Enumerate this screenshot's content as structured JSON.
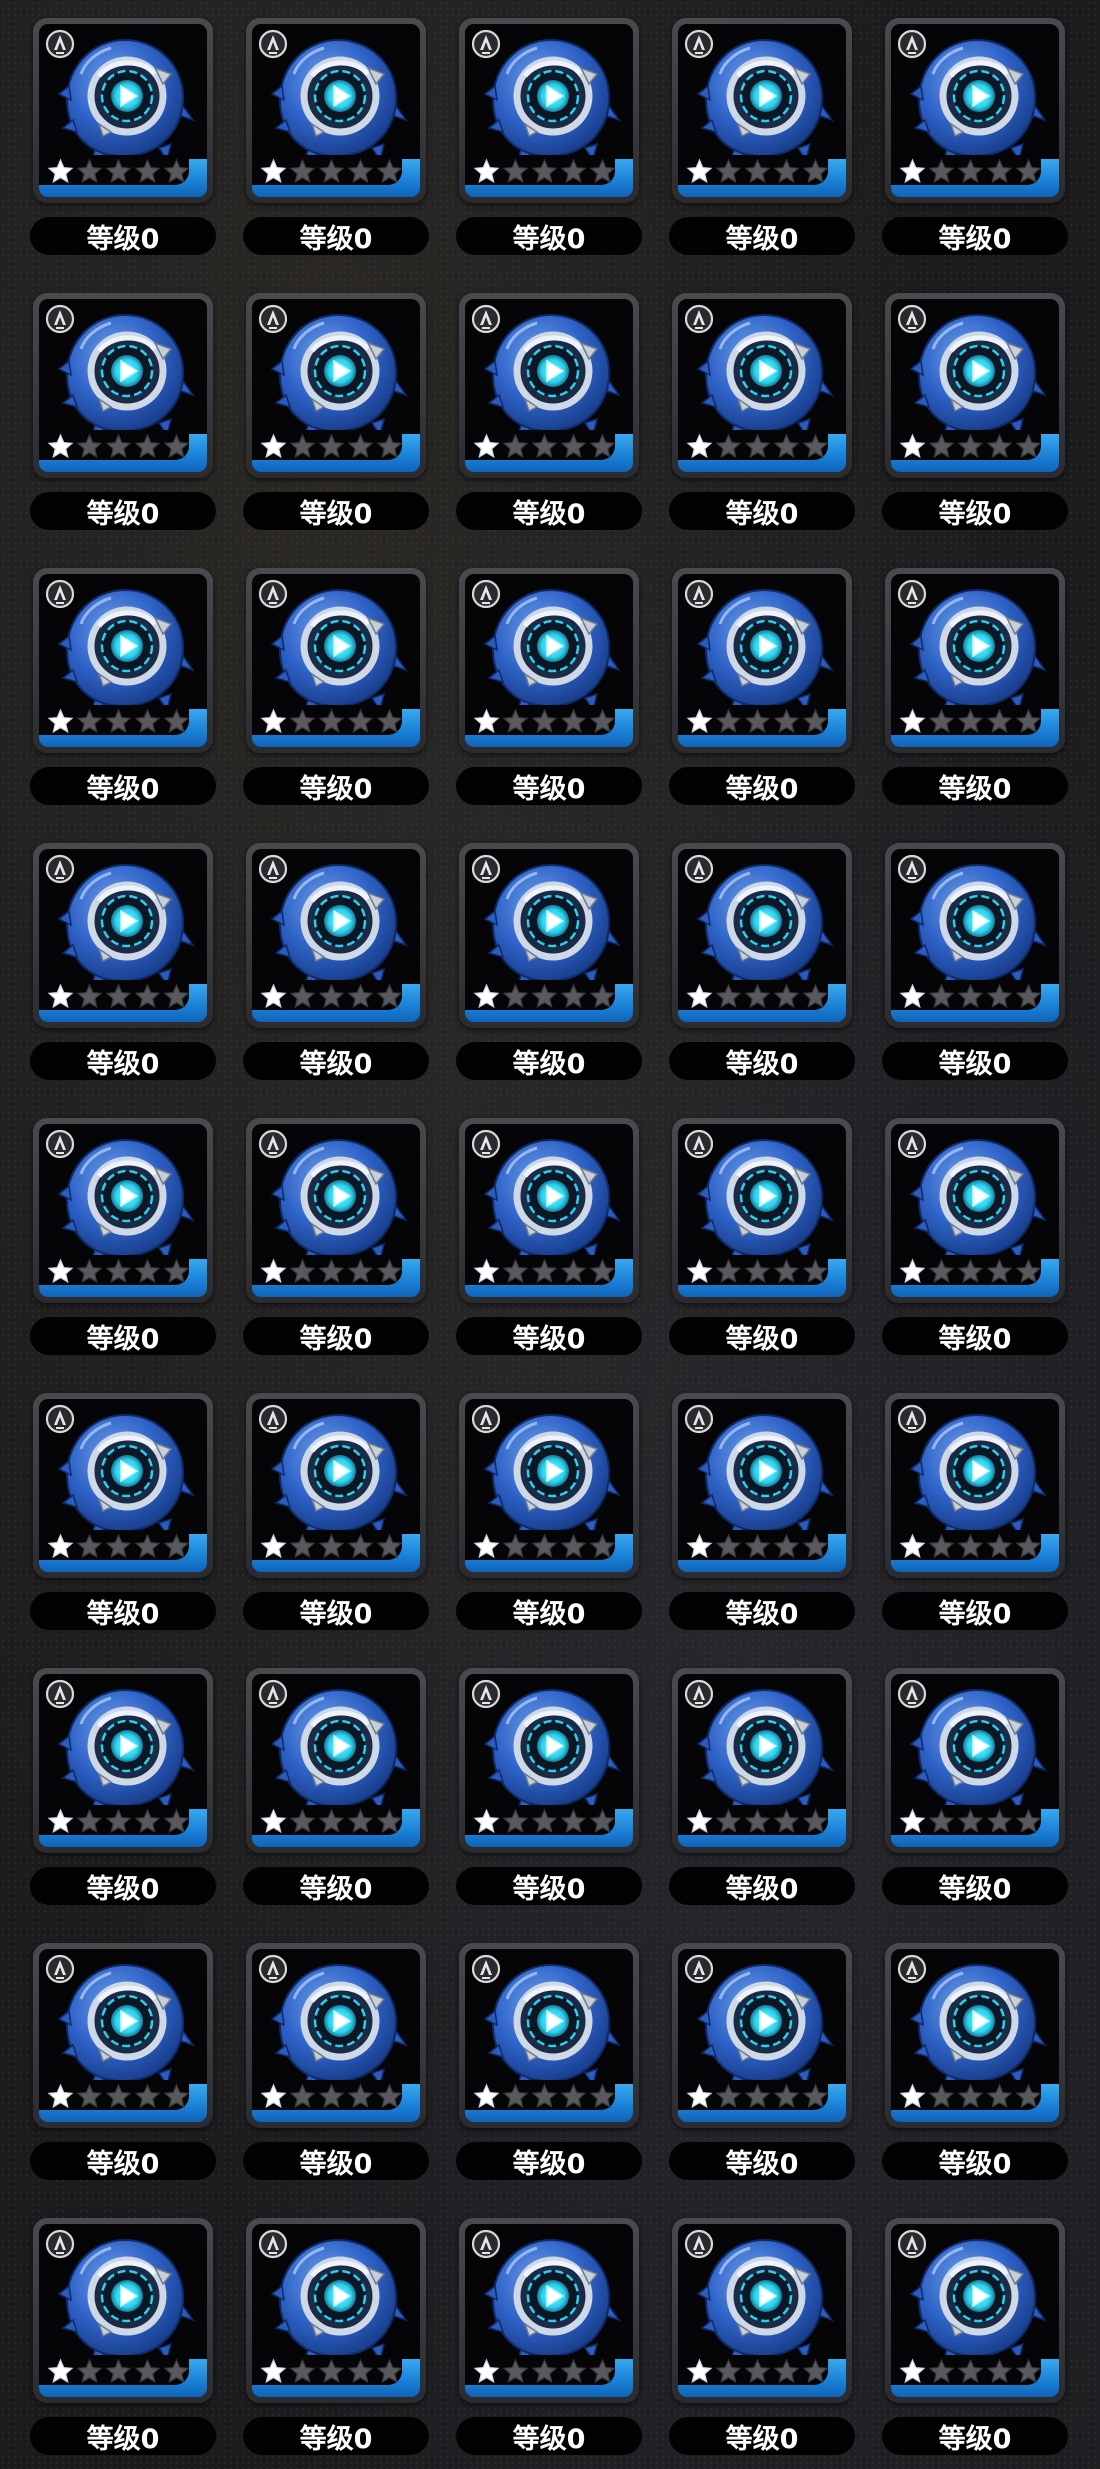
{
  "grid": {
    "rows": 9,
    "columns": 5
  },
  "item": {
    "name_icon": "blue-spiked-orb-gear-icon",
    "rarity_icon": "rarity-emblem-icon",
    "level_label": "等级0",
    "stars_total": 5,
    "stars_filled": 1
  },
  "colors": {
    "star_filled": "#ffffff",
    "star_empty": "#5a5a5e",
    "rarity_bar": "#2a93e5",
    "orb_primary": "#2f63c8",
    "core_glow": "#3fd7f0",
    "card_border": "#3c3c41",
    "level_pill_bg": "#020203"
  },
  "items": [
    {
      "level_label": "等级0"
    },
    {
      "level_label": "等级0"
    },
    {
      "level_label": "等级0"
    },
    {
      "level_label": "等级0"
    },
    {
      "level_label": "等级0"
    },
    {
      "level_label": "等级0"
    },
    {
      "level_label": "等级0"
    },
    {
      "level_label": "等级0"
    },
    {
      "level_label": "等级0"
    },
    {
      "level_label": "等级0"
    },
    {
      "level_label": "等级0"
    },
    {
      "level_label": "等级0"
    },
    {
      "level_label": "等级0"
    },
    {
      "level_label": "等级0"
    },
    {
      "level_label": "等级0"
    },
    {
      "level_label": "等级0"
    },
    {
      "level_label": "等级0"
    },
    {
      "level_label": "等级0"
    },
    {
      "level_label": "等级0"
    },
    {
      "level_label": "等级0"
    },
    {
      "level_label": "等级0"
    },
    {
      "level_label": "等级0"
    },
    {
      "level_label": "等级0"
    },
    {
      "level_label": "等级0"
    },
    {
      "level_label": "等级0"
    },
    {
      "level_label": "等级0"
    },
    {
      "level_label": "等级0"
    },
    {
      "level_label": "等级0"
    },
    {
      "level_label": "等级0"
    },
    {
      "level_label": "等级0"
    },
    {
      "level_label": "等级0"
    },
    {
      "level_label": "等级0"
    },
    {
      "level_label": "等级0"
    },
    {
      "level_label": "等级0"
    },
    {
      "level_label": "等级0"
    },
    {
      "level_label": "等级0"
    },
    {
      "level_label": "等级0"
    },
    {
      "level_label": "等级0"
    },
    {
      "level_label": "等级0"
    },
    {
      "level_label": "等级0"
    },
    {
      "level_label": "等级0"
    },
    {
      "level_label": "等级0"
    },
    {
      "level_label": "等级0"
    },
    {
      "level_label": "等级0"
    },
    {
      "level_label": "等级0"
    }
  ]
}
